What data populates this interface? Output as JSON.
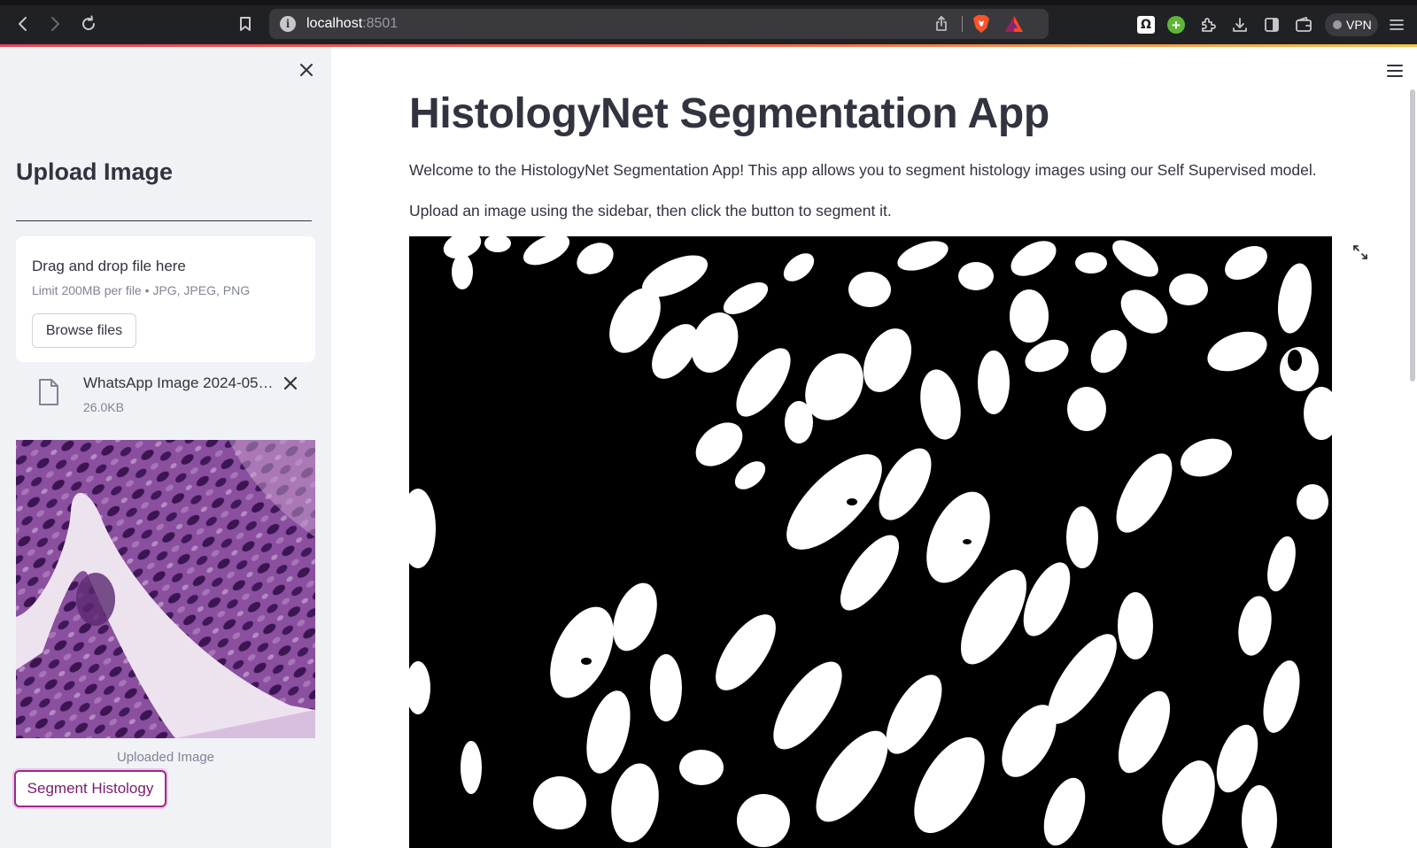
{
  "browser": {
    "url_host": "localhost",
    "url_port": ":8501",
    "vpn_label": "VPN"
  },
  "sidebar": {
    "title": "Upload Image",
    "uploader": {
      "drag_text": "Drag and drop file here",
      "limit_text": "Limit 200MB per file • JPG, JPEG, PNG",
      "browse_label": "Browse files"
    },
    "file": {
      "name": "WhatsApp Image 2024-05-0...",
      "size": "26.0KB"
    },
    "image_caption": "Uploaded Image",
    "segment_button_label": "Segment Histology"
  },
  "main": {
    "title": "HistologyNet Segmentation App",
    "intro": "Welcome to the HistologyNet Segmentation App! This app allows you to segment histology images using our Self Supervised model.",
    "instruction": "Upload an image using the sidebar, then click the button to segment it."
  },
  "colors": {
    "accent": "#9c2a8d",
    "sidebar_bg": "#f0f2f6",
    "text": "#31333f"
  }
}
